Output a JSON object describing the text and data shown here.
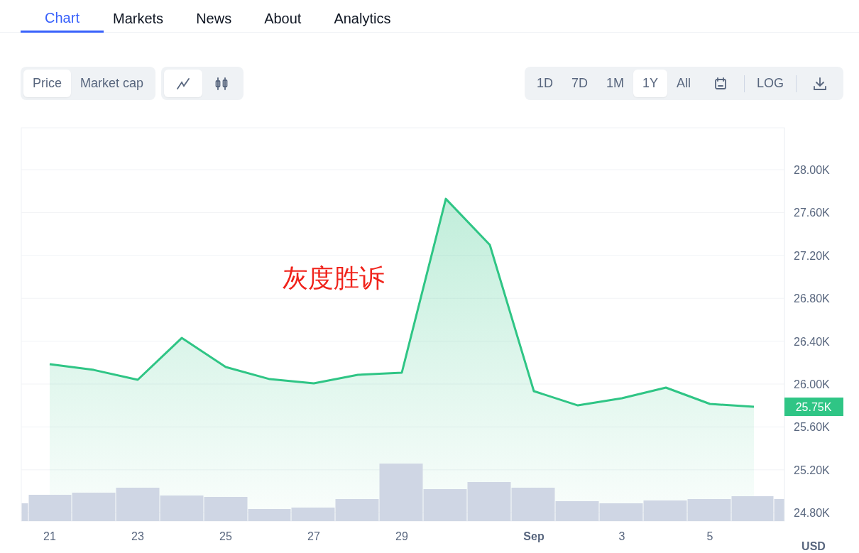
{
  "tabs": [
    {
      "label": "Chart",
      "selected": true
    },
    {
      "label": "Markets",
      "selected": false
    },
    {
      "label": "News",
      "selected": false
    },
    {
      "label": "About",
      "selected": false
    },
    {
      "label": "Analytics",
      "selected": false
    }
  ],
  "metric_toggle": [
    {
      "label": "Price",
      "selected": true
    },
    {
      "label": "Market cap",
      "selected": false
    }
  ],
  "chart_type_toggle": [
    {
      "kind": "line",
      "selected": true
    },
    {
      "kind": "candles",
      "selected": false
    }
  ],
  "periods": [
    {
      "label": "1D",
      "selected": false
    },
    {
      "label": "7D",
      "selected": false
    },
    {
      "label": "1M",
      "selected": false
    },
    {
      "label": "1Y",
      "selected": true
    },
    {
      "label": "All",
      "selected": false
    }
  ],
  "log_button": "LOG",
  "chart": {
    "current_price_badge": "25.75K",
    "currency": "USD",
    "chart_data": {
      "type": "area",
      "categories": [
        "21",
        null,
        "23",
        null,
        "25",
        null,
        "27",
        null,
        "29",
        null,
        null,
        "Sep",
        null,
        "3",
        null,
        "5",
        null
      ],
      "series": [
        {
          "color": "#2fc585",
          "values": [
            26185,
            26132,
            26040,
            26430,
            26159,
            26046,
            26007,
            26086,
            26106,
            27728,
            27298,
            25934,
            25801,
            25868,
            25967,
            25815,
            25788
          ]
        }
      ],
      "ylim": [
        24722,
        28391
      ],
      "grid": true,
      "yticks": [
        {
          "value": 24800,
          "label": "24.80K"
        },
        {
          "value": 25200,
          "label": "25.20K"
        },
        {
          "value": 25600,
          "label": "25.60K"
        },
        {
          "value": 26000,
          "label": "26.00K"
        },
        {
          "value": 26400,
          "label": "26.40K"
        },
        {
          "value": 26800,
          "label": "26.80K"
        },
        {
          "value": 27200,
          "label": "27.20K"
        },
        {
          "value": 27600,
          "label": "27.60K"
        },
        {
          "value": 28000,
          "label": "28.00K"
        }
      ],
      "annotations": [
        "灰度胜诉"
      ]
    }
  }
}
